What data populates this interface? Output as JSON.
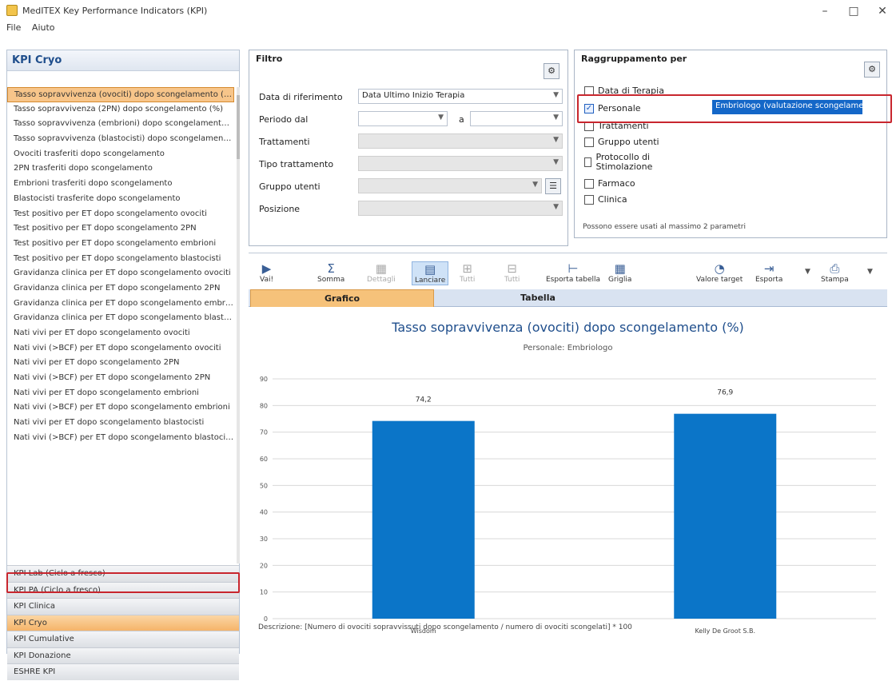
{
  "window": {
    "title": "MedITEX Key Performance Indicators (KPI)",
    "minimize": "–",
    "maximize": "□",
    "close": "✕"
  },
  "menu": {
    "items": [
      "File",
      "Aiuto"
    ]
  },
  "sidebar": {
    "header": "KPI Cryo",
    "items": [
      "Tasso sopravvivenza (ovociti) dopo scongelamento (%)",
      "Tasso sopravvivenza (2PN) dopo scongelamento (%)",
      "Tasso sopravvivenza (embrioni) dopo scongelamento (%)",
      "Tasso sopravvivenza (blastocisti) dopo scongelamento (%)",
      "Ovociti trasferiti dopo scongelamento",
      "2PN trasferiti dopo scongelamento",
      "Embrioni trasferiti dopo scongelamento",
      "Blastocisti trasferite dopo scongelamento",
      "Test positivo per ET dopo scongelamento ovociti",
      "Test positivo per ET dopo scongelamento 2PN",
      "Test positivo per ET dopo scongelamento embrioni",
      "Test positivo per ET dopo scongelamento blastocisti",
      "Gravidanza clinica per ET dopo scongelamento ovociti",
      "Gravidanza clinica per ET dopo scongelamento 2PN",
      "Gravidanza clinica per ET dopo scongelamento embrioni",
      "Gravidanza clinica per ET dopo scongelamento blastocisti",
      "Nati vivi per ET dopo scongelamento ovociti",
      "Nati vivi (>BCF) per ET dopo scongelamento ovociti",
      "Nati vivi per ET dopo scongelamento 2PN",
      "Nati vivi (>BCF) per ET dopo scongelamento 2PN",
      "Nati vivi per ET dopo scongelamento embrioni",
      "Nati vivi (>BCF) per ET dopo scongelamento embrioni",
      "Nati vivi per ET dopo scongelamento blastocisti",
      "Nati vivi (>BCF) per ET dopo scongelamento blastocisti"
    ],
    "groups": [
      "KPI Lab (Ciclo a fresco)",
      "KPI PA (Ciclo a fresco)",
      "KPI Clinica",
      "KPI Cryo",
      "KPI Cumulative",
      "KPI Donazione",
      "ESHRE KPI"
    ]
  },
  "filter": {
    "title": "Filtro",
    "fields": [
      {
        "label": "Data di riferimento",
        "value": "Data Ultimo Inizio Terapia"
      },
      {
        "label": "Periodo dal",
        "value": "",
        "to_label": "a",
        "to_value": ""
      },
      {
        "label": "Trattamenti",
        "value": ""
      },
      {
        "label": "Tipo trattamento",
        "value": ""
      },
      {
        "label": "Gruppo utenti",
        "value": ""
      },
      {
        "label": "Posizione",
        "value": ""
      }
    ]
  },
  "grouping": {
    "title": "Raggruppamento per",
    "options": [
      {
        "label": "Data di Terapia",
        "checked": false
      },
      {
        "label": "Personale",
        "checked": true
      },
      {
        "label": "Trattamenti",
        "checked": false
      },
      {
        "label": "Gruppo utenti",
        "checked": false
      },
      {
        "label": "Protocollo di Stimolazione",
        "checked": false
      },
      {
        "label": "Farmaco",
        "checked": false
      },
      {
        "label": "Clinica",
        "checked": false
      }
    ],
    "personale_select": "Embriologo (valutazione scongelamento)",
    "hint": "Possono essere usati al massimo 2 parametri"
  },
  "toolbar": {
    "buttons": [
      "Vai!",
      "Somma",
      "Dettagli",
      "Lanciare",
      "Tutti",
      "Tutti",
      "Esporta tabella",
      "Griglia",
      "Valore target",
      "Esporta",
      "Stampa"
    ]
  },
  "tabs": [
    "Grafico",
    "Tabella"
  ],
  "chart_data": {
    "type": "bar",
    "title": "Tasso sopravvivenza (ovociti) dopo scongelamento (%)",
    "subtitle": "Personale: Embriologo",
    "categories": [
      "Wisdom",
      "Kelly De Groot S.B."
    ],
    "values": [
      74.2,
      76.9
    ],
    "data_labels": [
      "74,2",
      "76,9"
    ],
    "ylim": [
      0,
      90
    ],
    "yticks": [
      0,
      10,
      20,
      30,
      40,
      50,
      60,
      70,
      80,
      90
    ],
    "grid": true,
    "bar_color": "#0b75c8"
  },
  "footnote": "Descrizione: [Numero di ovociti sopravvissuti dopo scongelamento / numero di ovociti scongelati] * 100"
}
